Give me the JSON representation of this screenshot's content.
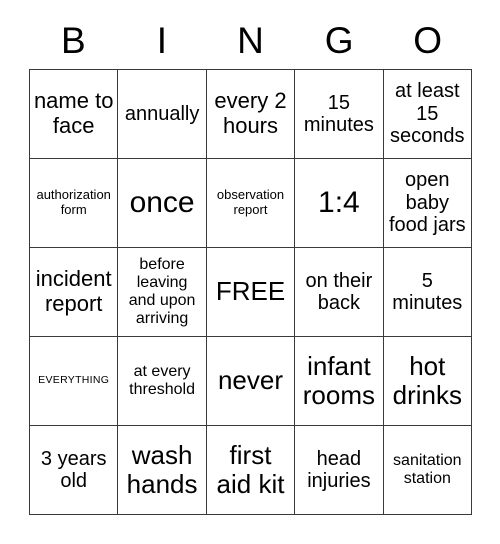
{
  "card": {
    "header_letters": [
      "B",
      "I",
      "N",
      "G",
      "O"
    ],
    "background_color": "#ffffff",
    "border_color": "#3a3a3a",
    "text_color": "#000000",
    "rows": 5,
    "columns": 5,
    "cells": [
      {
        "text": "name to face",
        "size": "lg"
      },
      {
        "text": "annually",
        "size": "md"
      },
      {
        "text": "every 2 hours",
        "size": "lg"
      },
      {
        "text": "15 minutes",
        "size": "md"
      },
      {
        "text": "at least 15 seconds",
        "size": "md"
      },
      {
        "text": "authorization form",
        "size": "xs"
      },
      {
        "text": "once",
        "size": "xxl"
      },
      {
        "text": "observation report",
        "size": "xs"
      },
      {
        "text": "1:4",
        "size": "xxl"
      },
      {
        "text": "open baby food jars",
        "size": "md"
      },
      {
        "text": "incident report",
        "size": "lg"
      },
      {
        "text": "before leaving and upon arriving",
        "size": "sm"
      },
      {
        "text": "FREE",
        "size": "xl"
      },
      {
        "text": "on their back",
        "size": "md"
      },
      {
        "text": "5 minutes",
        "size": "md"
      },
      {
        "text": "EVERYTHING",
        "size": "xxs"
      },
      {
        "text": "at every threshold",
        "size": "sm"
      },
      {
        "text": "never",
        "size": "xl"
      },
      {
        "text": "infant rooms",
        "size": "xl"
      },
      {
        "text": "hot drinks",
        "size": "xl"
      },
      {
        "text": "3 years old",
        "size": "md"
      },
      {
        "text": "wash hands",
        "size": "xl"
      },
      {
        "text": "first aid kit",
        "size": "xl"
      },
      {
        "text": "head injuries",
        "size": "md"
      },
      {
        "text": "sanitation station",
        "size": "sm"
      }
    ]
  }
}
